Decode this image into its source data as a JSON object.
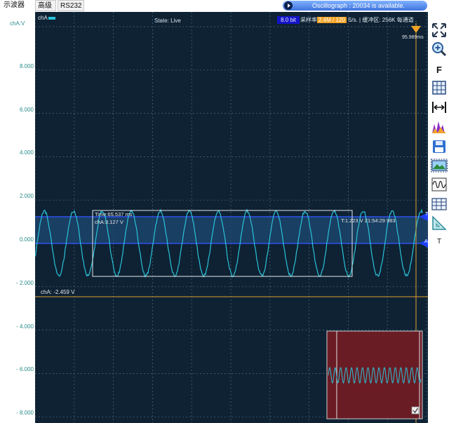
{
  "tabs": [
    "示波器",
    "高级",
    "RS232"
  ],
  "notice": "Oscillograph : 20034 is available.",
  "y_axis": {
    "unit": "chA:V",
    "labels": [
      "8.000",
      "6.000",
      "4.000",
      "2.000",
      "0.000",
      "- 2.000",
      "- 4.000",
      "- 6.000",
      "- 8.000"
    ]
  },
  "scope": {
    "channel": "chA",
    "state": "State: Live",
    "bit_depth": "8.0 bit",
    "rate_prefix": "采样率",
    "rate_value": "2.4M / 120",
    "rate_suffix": "S/s. | 缓冲区: 256K 每通道 .",
    "trigger_time": "95.989ms",
    "marker_t": "T",
    "marker_a": "A",
    "cursor_label": "chA: -2.459 V",
    "measure_time": "Time:65.537 ms",
    "measure_volt": "chA:3.127 V",
    "trigger_info": "T:1.223 V   21:54:29 983",
    "wave_color": "#2bc2d8",
    "grid_color": "#4b6a80",
    "cursor_color": "#e0a030",
    "trigger_line_color": "#3050f0"
  },
  "toolbar": {
    "icons": [
      "fit-screen-icon",
      "zoom-icon",
      "f-icon",
      "grid-icon",
      "measure-width-icon",
      "spectrum-icon",
      "save-icon",
      "screenshot-icon",
      "wave-icon",
      "table-icon",
      "ruler-icon",
      "text-icon"
    ],
    "f_label": "F",
    "t_label": "T"
  }
}
